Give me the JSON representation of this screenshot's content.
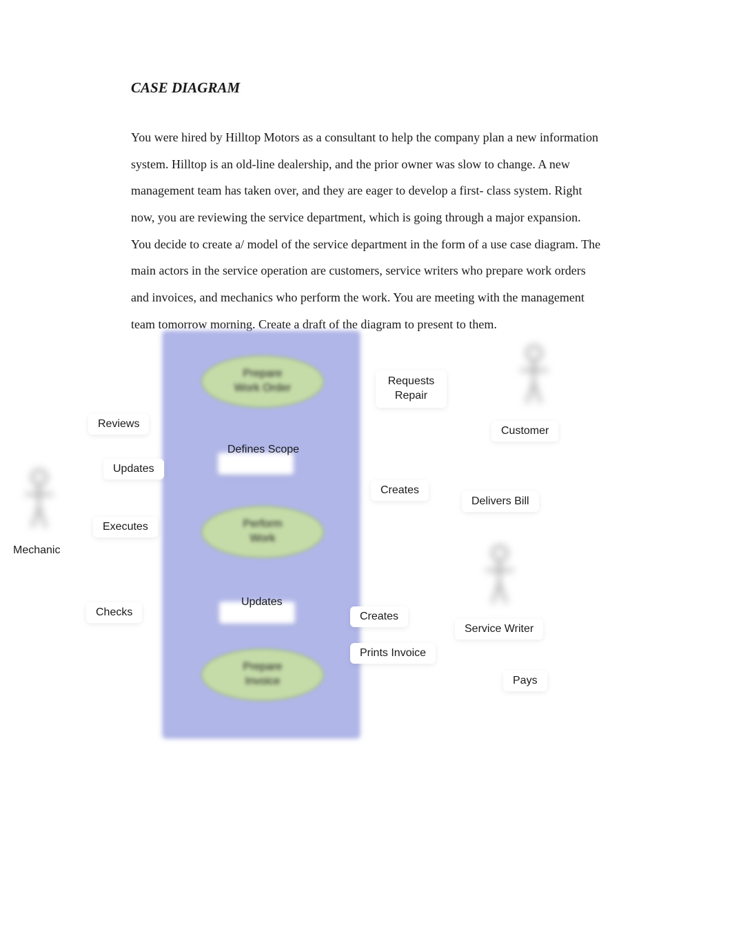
{
  "title": "CASE DIAGRAM",
  "description": "You were hired by Hilltop Motors as a consultant to help the company plan a new information system. Hilltop is an old-line dealership, and the prior owner was slow to change. A new management team has taken over, and they are eager to develop a first- class system. Right now, you are reviewing the service department, which is going through a major expansion. You decide to create a/ model of the service department in the form of a use case diagram. The main actors in the service operation are customers, service writers who prepare work orders and invoices, and mechanics who perform the work. You are meeting with the management team tomorrow morning. Create a draft of the diagram to present to them.",
  "actors": {
    "mechanic": "Mechanic",
    "customer": "Customer",
    "service_writer": "Service Writer"
  },
  "usecases": {
    "prepare_work_order": "Prepare Work Order",
    "perform_work": "Perform Work",
    "prepare_invoice": "Prepare Invoice"
  },
  "relations": {
    "reviews": "Reviews",
    "updates1": "Updates",
    "executes": "Executes",
    "checks": "Checks",
    "defines_scope": "Defines Scope",
    "updates2": "Updates",
    "requests_repair": "Requests Repair",
    "creates1": "Creates",
    "delivers_bill": "Delivers Bill",
    "creates2": "Creates",
    "prints_invoice": "Prints Invoice",
    "pays": "Pays"
  }
}
